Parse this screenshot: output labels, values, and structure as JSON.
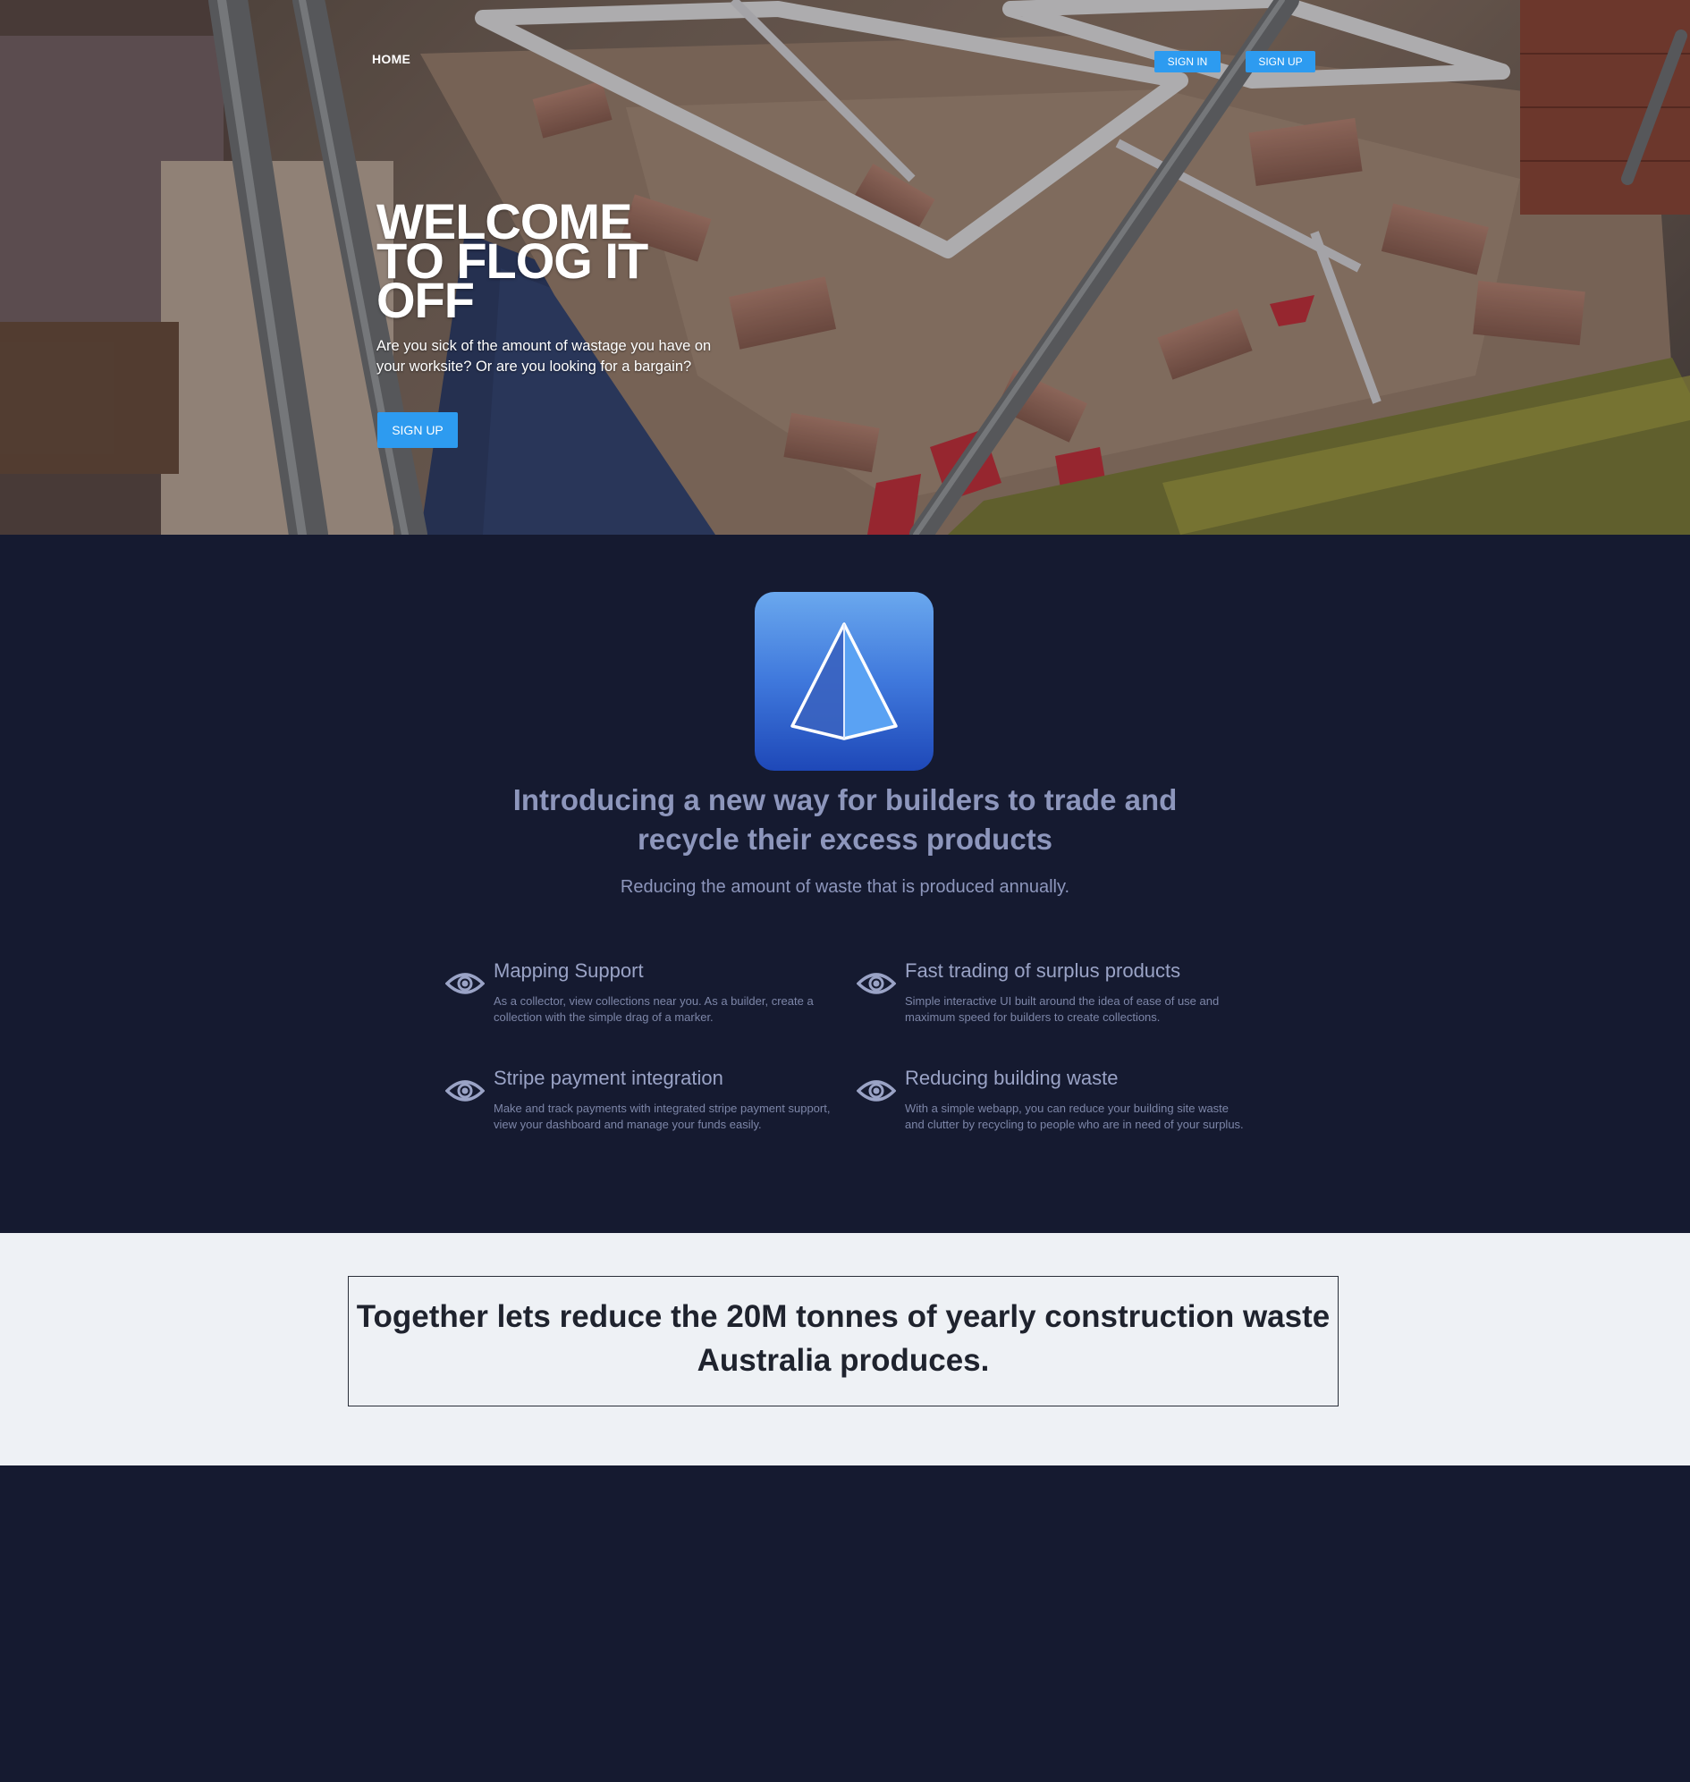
{
  "nav": {
    "home_label": "HOME",
    "signin_label": "SIGN IN",
    "signup_label": "SIGN UP"
  },
  "hero": {
    "title": "WELCOME TO FLOG IT OFF",
    "text": "Are you sick of the amount of wastage you have on your worksite? Or are you looking for a bargain?",
    "cta_label": "SIGN UP",
    "background_description": "construction-skip-full-of-rubble"
  },
  "features": {
    "logo_icon": "pyramid-icon",
    "heading": "Introducing a new way for builders to trade and recycle their excess products",
    "subheading": "Reducing the amount of waste that is produced annually.",
    "items": [
      {
        "icon": "eye-icon",
        "title": "Mapping Support",
        "desc": "As a collector, view collections near you. As a builder, create a collection with the simple drag of a marker."
      },
      {
        "icon": "eye-icon",
        "title": "Fast trading of surplus products",
        "desc": "Simple interactive UI built around the idea of ease of use and maximum speed for builders to create collections."
      },
      {
        "icon": "eye-icon",
        "title": "Stripe payment integration",
        "desc": "Make and track payments with integrated stripe payment support, view your dashboard and manage your funds easily."
      },
      {
        "icon": "eye-icon",
        "title": "Reducing building waste",
        "desc": "With a simple webapp, you can reduce your building site waste and clutter by recycling to people who are in need of your surplus."
      }
    ]
  },
  "quote": {
    "text": "Together lets reduce the 20M tonnes of yearly construction waste Australia produces."
  },
  "colors": {
    "accent": "#2d9bf0",
    "dark_bg": "#151a30",
    "light_bg": "#eef1f5",
    "muted_text": "#8d96bc"
  }
}
